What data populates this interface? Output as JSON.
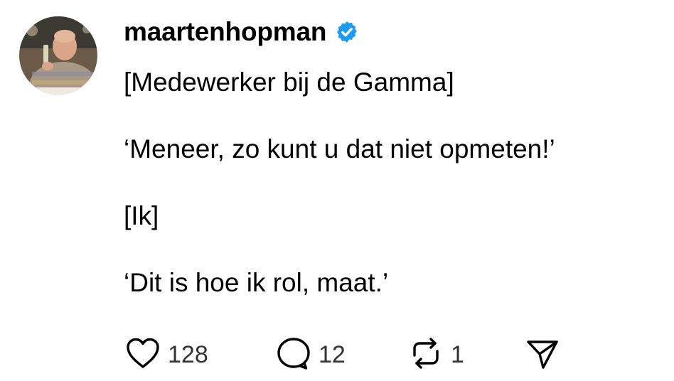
{
  "author": {
    "username": "maartenhopman",
    "verified": true,
    "verified_color": "#1D9BF0",
    "avatar_icon": "profile-photo"
  },
  "post": {
    "lines": [
      "[Medewerker bij de Gamma]",
      "‘Meneer, zo kunt u dat niet opmeten!’",
      "[Ik]",
      "‘Dit is hoe ik rol, maat.’"
    ]
  },
  "actions": {
    "like": {
      "icon": "heart-icon",
      "count": "128"
    },
    "reply": {
      "icon": "comment-icon",
      "count": "12"
    },
    "repost": {
      "icon": "repost-icon",
      "count": "1"
    },
    "share": {
      "icon": "send-icon"
    }
  }
}
